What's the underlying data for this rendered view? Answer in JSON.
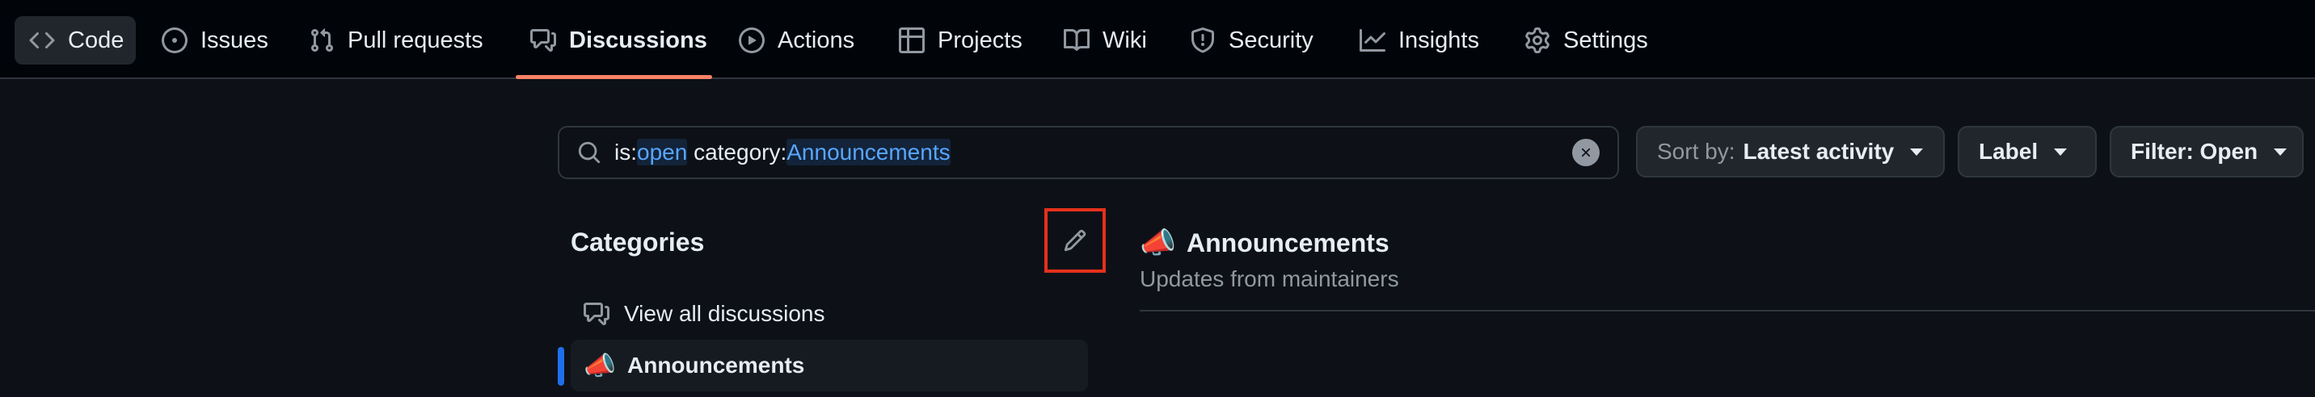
{
  "nav": {
    "tabs": [
      {
        "label": "Code",
        "icon": "code-icon"
      },
      {
        "label": "Issues",
        "icon": "issue-opened-icon"
      },
      {
        "label": "Pull requests",
        "icon": "git-pull-request-icon"
      },
      {
        "label": "Discussions",
        "icon": "comment-discussion-icon",
        "active": true
      },
      {
        "label": "Actions",
        "icon": "play-icon"
      },
      {
        "label": "Projects",
        "icon": "table-icon"
      },
      {
        "label": "Wiki",
        "icon": "book-icon"
      },
      {
        "label": "Security",
        "icon": "shield-icon"
      },
      {
        "label": "Insights",
        "icon": "graph-icon"
      },
      {
        "label": "Settings",
        "icon": "gear-icon"
      }
    ]
  },
  "search": {
    "q1_key": "is:",
    "q1_value": "open",
    "q2_key": " category:",
    "q2_value": "Announcements"
  },
  "toolbar": {
    "sort_prefix": "Sort by:",
    "sort_value": "Latest activity",
    "label_button": "Label",
    "filter_button": "Filter: Open"
  },
  "sidebar": {
    "title": "Categories",
    "items": [
      {
        "label": "View all discussions",
        "icon": "comment-discussion-icon"
      },
      {
        "label": "Announcements",
        "emoji": "📣",
        "selected": true
      }
    ]
  },
  "category": {
    "emoji": "📣",
    "title": "Announcements",
    "description": "Updates from maintainers"
  },
  "colors": {
    "background": "#0d1117",
    "nav_background": "#010409",
    "accent_underline": "#f78166",
    "link_blue": "#58a6ff",
    "selected_indicator": "#1f6feb",
    "highlight_box": "#e5301c"
  }
}
